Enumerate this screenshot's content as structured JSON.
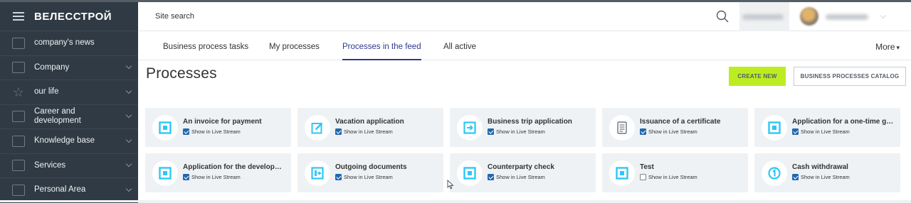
{
  "app": {
    "logo": "ВЕЛЕССТРОЙ",
    "accent_color": "#2d3a8c",
    "create_color": "#bbed21",
    "icon_color": "#2fc6f6"
  },
  "header": {
    "search_placeholder": "Site search"
  },
  "sidebar": {
    "items": [
      {
        "label": "company's news",
        "icon": "news-icon",
        "has_chevron": false
      },
      {
        "label": "Company",
        "icon": "company-icon",
        "has_chevron": true
      },
      {
        "label": "our life",
        "icon": "star-icon",
        "has_chevron": true
      },
      {
        "label": "Career and development",
        "icon": "chart-icon",
        "has_chevron": true
      },
      {
        "label": "Knowledge base",
        "icon": "book-icon",
        "has_chevron": true
      },
      {
        "label": "Services",
        "icon": "services-icon",
        "has_chevron": true
      },
      {
        "label": "Personal Area",
        "icon": "grid-icon",
        "has_chevron": true
      }
    ]
  },
  "tabs": {
    "items": [
      {
        "label": "Business process tasks",
        "active": false
      },
      {
        "label": "My processes",
        "active": false
      },
      {
        "label": "Processes in the feed",
        "active": true
      },
      {
        "label": "All active",
        "active": false
      }
    ],
    "more_label": "More"
  },
  "main": {
    "title": "Processes",
    "create_button": "CREATE NEW",
    "catalog_button": "BUSINESS PROCESSES CATALOG",
    "checkbox_label": "Show in Live Stream",
    "processes": [
      {
        "title": "An invoice for payment",
        "checked": true,
        "icon": "square-icon"
      },
      {
        "title": "Vacation application",
        "checked": true,
        "icon": "edit-icon"
      },
      {
        "title": "Business trip application",
        "checked": true,
        "icon": "arrow-box-icon"
      },
      {
        "title": "Issuance of a certificate",
        "checked": true,
        "icon": "document-icon"
      },
      {
        "title": "Application for a one-time gu...",
        "checked": true,
        "icon": "square-icon"
      },
      {
        "title": "Application for the developm...",
        "checked": true,
        "icon": "square-icon"
      },
      {
        "title": "Outgoing documents",
        "checked": true,
        "icon": "export-icon"
      },
      {
        "title": "Counterparty check",
        "checked": true,
        "icon": "square-icon"
      },
      {
        "title": "Test",
        "checked": false,
        "icon": "square-icon"
      },
      {
        "title": "Cash withdrawal",
        "checked": true,
        "icon": "number-one-icon"
      }
    ]
  }
}
